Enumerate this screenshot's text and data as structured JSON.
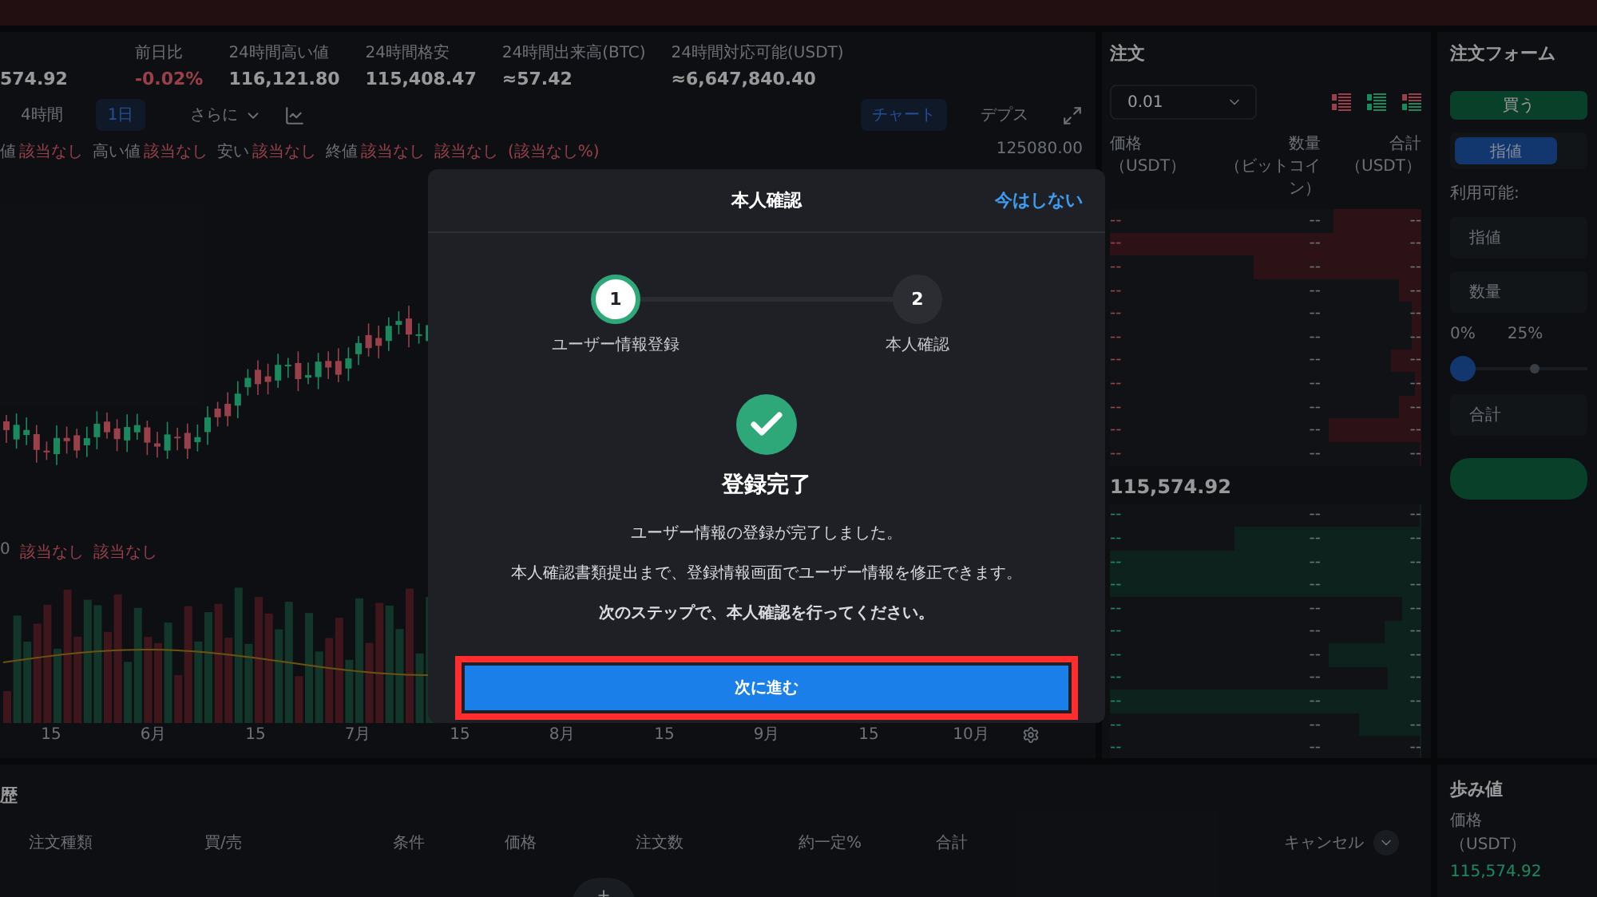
{
  "ticker": {
    "price": "574.92",
    "stats": [
      {
        "label": "前日比",
        "value": "-0.02%",
        "negative": true
      },
      {
        "label": "24時間高い値",
        "value": "116,121.80",
        "negative": false
      },
      {
        "label": "24時間格安",
        "value": "115,408.47",
        "negative": false
      },
      {
        "label": "24時間出来高(BTC)",
        "value": "≈57.42",
        "negative": false
      },
      {
        "label": "24時間対応可能(USDT)",
        "value": "≈6,647,840.40",
        "negative": false
      }
    ]
  },
  "chart_toolbar": {
    "intervals": [
      {
        "label": "4時間",
        "selected": false
      },
      {
        "label": "1日",
        "selected": true
      }
    ],
    "more": "さらに",
    "views": [
      {
        "label": "チャート",
        "selected": true
      },
      {
        "label": "デプス",
        "selected": false
      }
    ]
  },
  "ohlc_legend": [
    {
      "label": "値",
      "value": "該当なし"
    },
    {
      "label": "高い値",
      "value": "該当なし"
    },
    {
      "label": "安い",
      "value": "該当なし"
    },
    {
      "label": "終値",
      "value": "該当なし"
    },
    {
      "value": "該当なし"
    },
    {
      "value": "(該当なし%)"
    }
  ],
  "price_axis_label": "125080.00",
  "volume_legend": {
    "label": "0",
    "values": [
      "該当なし",
      "該当なし"
    ]
  },
  "time_axis": [
    "15",
    "6月",
    "15",
    "7月",
    "15",
    "8月",
    "15",
    "9月",
    "15",
    "10月"
  ],
  "order_book": {
    "title": "注文",
    "precision": "0.01",
    "columns": [
      {
        "label": "価格",
        "unit": "（USDT）"
      },
      {
        "label": "数量",
        "unit": "（ビットコイン）"
      },
      {
        "label": "合計",
        "unit": "（USDT）"
      }
    ],
    "asks": [
      {
        "price": "--",
        "amount": "--",
        "total": "--",
        "level": 0.28
      },
      {
        "price": "--",
        "amount": "--",
        "total": "--",
        "level": 1.0
      },
      {
        "price": "--",
        "amount": "--",
        "total": "--",
        "level": 0.54
      },
      {
        "price": "--",
        "amount": "--",
        "total": "--",
        "level": 0.07
      },
      {
        "price": "--",
        "amount": "--",
        "total": "--",
        "level": 0.03
      },
      {
        "price": "--",
        "amount": "--",
        "total": "--",
        "level": 0.03
      },
      {
        "price": "--",
        "amount": "--",
        "total": "--",
        "level": 0.1
      },
      {
        "price": "--",
        "amount": "--",
        "total": "--",
        "level": 0.02
      },
      {
        "price": "--",
        "amount": "--",
        "total": "--",
        "level": 0.07
      },
      {
        "price": "--",
        "amount": "--",
        "total": "--",
        "level": 0.3
      },
      {
        "price": "--",
        "amount": "--",
        "total": "--",
        "level": 0
      }
    ],
    "last_price": "115,574.92",
    "bids": [
      {
        "price": "--",
        "amount": "--",
        "total": "--",
        "level": 0
      },
      {
        "price": "--",
        "amount": "--",
        "total": "--",
        "level": 0.6
      },
      {
        "price": "--",
        "amount": "--",
        "total": "--",
        "level": 1.0
      },
      {
        "price": "--",
        "amount": "--",
        "total": "--",
        "level": 1.0
      },
      {
        "price": "--",
        "amount": "--",
        "total": "--",
        "level": 0.06
      },
      {
        "price": "--",
        "amount": "--",
        "total": "--",
        "level": 0.12
      },
      {
        "price": "--",
        "amount": "--",
        "total": "--",
        "level": 0.3
      },
      {
        "price": "--",
        "amount": "--",
        "total": "--",
        "level": 0.11
      },
      {
        "price": "--",
        "amount": "--",
        "total": "--",
        "level": 1.0
      },
      {
        "price": "--",
        "amount": "--",
        "total": "--",
        "level": 0.2
      },
      {
        "price": "--",
        "amount": "--",
        "total": "--",
        "level": 0
      }
    ]
  },
  "order_form": {
    "title": "注文フォーム",
    "buy_label": "買う",
    "tabs": [
      {
        "label": "指値",
        "selected": true
      }
    ],
    "available_label": "利用可能:",
    "fields": [
      {
        "placeholder": "指値"
      },
      {
        "placeholder": "数量"
      }
    ],
    "slider": {
      "ticks": [
        "0%",
        "25%"
      ],
      "level": 0
    },
    "total_field": {
      "placeholder": "合計"
    }
  },
  "order_history": {
    "title": "歴",
    "columns": [
      "注文種類",
      "買/売",
      "条件",
      "価格",
      "注文数",
      "約一定%",
      "合計"
    ],
    "cancel_label": "キャンセル"
  },
  "trades": {
    "title": "歩み値",
    "column": {
      "label": "価格",
      "unit": "（USDT）"
    },
    "rows": [
      "115,574.92"
    ]
  },
  "dialog": {
    "title": "本人確認",
    "skip_label": "今はしない",
    "steps": [
      {
        "number": "1",
        "label": "ユーザー情報登録",
        "completed": true
      },
      {
        "number": "2",
        "label": "本人確認",
        "completed": false
      }
    ],
    "heading": "登録完了",
    "lines": [
      {
        "text": "ユーザー情報の登録が完了しました。",
        "bold": false
      },
      {
        "text": "本人確認書類提出まで、登録情報画面でユーザー情報を修正できます。",
        "bold": false
      },
      {
        "text": "次のステップで、本人確認を行ってください。",
        "bold": true
      }
    ],
    "next_label": "次に進む"
  }
}
